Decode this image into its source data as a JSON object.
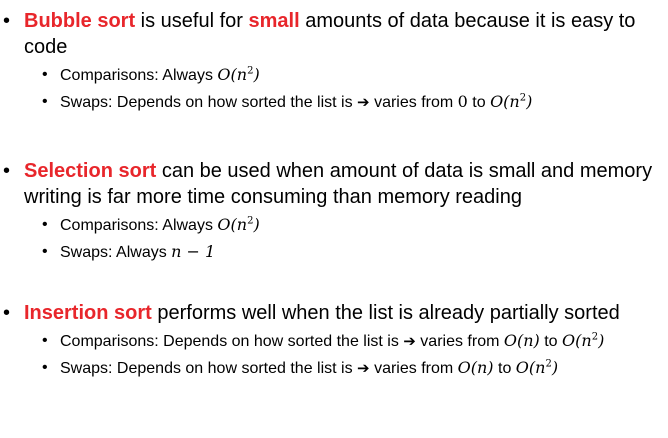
{
  "bubble": {
    "bullet": "•",
    "name": "Bubble sort",
    "text_a": " is useful for ",
    "emph": "small",
    "text_b": " amounts of data because it is easy to code",
    "comparisons": {
      "bullet": "•",
      "label": "Comparisons: Always ",
      "math": "O(n",
      "exp": "2",
      "math_close": ")"
    },
    "swaps": {
      "bullet": "•",
      "label": "Swaps: Depends on how sorted the list is ",
      "arrow": "➔",
      "mid": " varies from ",
      "zero": "0",
      "to": " to ",
      "math": "O(n",
      "exp": "2",
      "math_close": ")"
    }
  },
  "selection": {
    "bullet": "•",
    "name": "Selection sort",
    "text": " can be used when amount of data is small and memory writing is far more time consuming than memory reading",
    "comparisons": {
      "bullet": "•",
      "label": "Comparisons: Always ",
      "math": "O(n",
      "exp": "2",
      "math_close": ")"
    },
    "swaps": {
      "bullet": "•",
      "label": "Swaps: Always ",
      "math": "n − 1"
    }
  },
  "insertion": {
    "bullet": "•",
    "name": "Insertion sort",
    "text": " performs well when the list is already partially sorted",
    "comparisons": {
      "bullet": "•",
      "label": "Comparisons: Depends on how sorted the list is ",
      "arrow": "➔",
      "mid": " varies from ",
      "math_a": "O(n)",
      "to": " to ",
      "math": "O(n",
      "exp": "2",
      "math_close": ")"
    },
    "swaps": {
      "bullet": "•",
      "label": "Swaps: Depends on how sorted the list is ",
      "arrow": "➔",
      "mid": " varies from ",
      "math_a": "O(n)",
      "to": " to ",
      "math": "O(n",
      "exp": "2",
      "math_close": ")"
    }
  }
}
